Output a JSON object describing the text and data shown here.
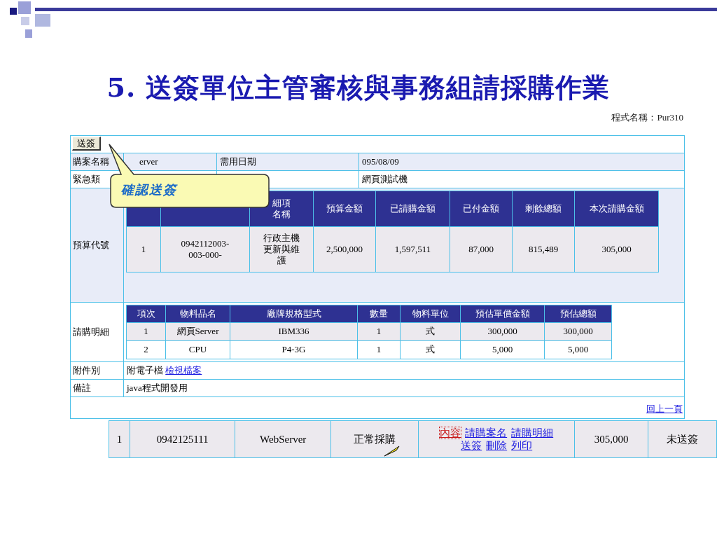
{
  "slide_title": "5. 送簽單位主管審核與事務組請採購作業",
  "program_name": "程式名稱：Pur310",
  "form": {
    "send_button": "送簽",
    "info_rows": [
      {
        "label": "購案名稱",
        "value": "erver",
        "label_2": "需用日期",
        "value_2": "095/08/09"
      },
      {
        "label": "緊急類",
        "value": "",
        "label_2": "",
        "value_2": "網頁測試機"
      }
    ],
    "budget": {
      "label": "預算代號",
      "columns": [
        null,
        null,
        [
          "細項",
          "名稱"
        ],
        "預算金額",
        "已請購金額",
        "已付金額",
        "剩餘總額",
        "本次請購金額"
      ],
      "rows": [
        [
          "1",
          [
            "0942112003-",
            "003-000-"
          ],
          [
            "行政主機",
            "更新與維",
            "護"
          ],
          "2,500,000",
          "1,597,511",
          "87,000",
          "815,489",
          "305,000"
        ]
      ]
    },
    "detail": {
      "label": "請購明細",
      "columns": [
        "項次",
        "物料品名",
        "廠牌規格型式",
        "數量",
        "物料單位",
        "預估單價金額",
        "預估總額"
      ],
      "rows": [
        [
          "1",
          "網頁Server",
          "IBM336",
          "1",
          "式",
          "300,000",
          "300,000"
        ],
        [
          "2",
          "CPU",
          "P4-3G",
          "1",
          "式",
          "5,000",
          "5,000"
        ]
      ]
    },
    "attachment": {
      "label": "附件別",
      "text": "附電子檔",
      "link": "檢視檔案"
    },
    "note": {
      "label": "備註",
      "text": "java程式開發用"
    },
    "back_link": "回上一頁"
  },
  "callout": "確認送簽",
  "list_row": {
    "cells": [
      "1",
      "0942125111",
      "WebServer",
      "正常採購"
    ],
    "links": [
      {
        "label": "內容",
        "selected": true
      },
      {
        "label": "請購案名",
        "selected": false
      },
      {
        "label": "請購明細",
        "selected": false
      },
      {
        "label": "送簽",
        "selected": false
      },
      {
        "label": "刪除",
        "selected": false
      },
      {
        "label": "列印",
        "selected": false
      }
    ],
    "amount": "305,000",
    "status": "未送簽"
  }
}
